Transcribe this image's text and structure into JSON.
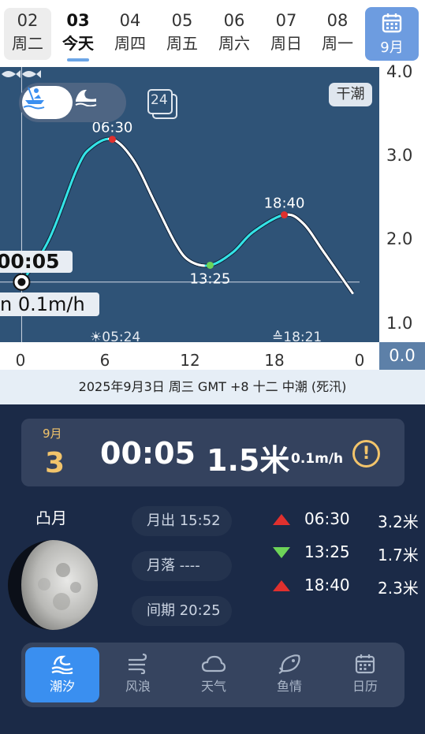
{
  "date_strip": {
    "days": [
      {
        "num": "02",
        "weekday": "周二"
      },
      {
        "num": "03",
        "weekday": "今天"
      },
      {
        "num": "04",
        "weekday": "周四"
      },
      {
        "num": "05",
        "weekday": "周五"
      },
      {
        "num": "06",
        "weekday": "周六"
      },
      {
        "num": "07",
        "weekday": "周日"
      },
      {
        "num": "08",
        "weekday": "周一"
      }
    ],
    "calendar_button": {
      "label": "9月",
      "icon": "calendar-icon"
    }
  },
  "chart": {
    "mode_options": [
      {
        "icon": "boat-fishing-icon",
        "active": true
      },
      {
        "icon": "wave-icon",
        "active": false
      }
    ],
    "range_icon_label": "24",
    "dry_tide_label": "干潮",
    "fish_icon": "fish-icon",
    "cursor": {
      "time": "00:05",
      "rate": "n  0.1m/h"
    },
    "sunrise": "05:24",
    "sunset": "18:21",
    "zero_value": "0.0",
    "colors": {
      "rising": "#34e3e6",
      "falling": "#ffffff",
      "background": "#2f5377",
      "high_marker": "#e0302e",
      "low_marker": "#6dd458"
    }
  },
  "chart_data": {
    "type": "line",
    "title": "",
    "xlabel": "",
    "ylabel": "",
    "xlim": [
      0,
      24
    ],
    "ylim": [
      0.75,
      4.0
    ],
    "x_ticks": [
      "0",
      "6",
      "12",
      "18",
      "0"
    ],
    "y_ticks": [
      "1.0",
      "2.0",
      "3.0",
      "4.0"
    ],
    "series": [
      {
        "x": [
          0.08,
          2,
          4,
          5,
          6.5,
          8,
          9.5,
          11,
          12,
          13.42,
          15,
          16.5,
          18.67,
          20,
          21.5,
          23.5
        ],
        "y": [
          1.5,
          2.0,
          2.85,
          3.1,
          3.2,
          2.95,
          2.45,
          1.95,
          1.75,
          1.7,
          1.85,
          2.1,
          2.3,
          2.2,
          1.85,
          1.37
        ]
      }
    ],
    "extremes": [
      {
        "time": "06:30",
        "x": 6.5,
        "y": 3.2,
        "kind": "high"
      },
      {
        "time": "13:25",
        "x": 13.42,
        "y": 1.7,
        "kind": "low"
      },
      {
        "time": "18:40",
        "x": 18.67,
        "y": 2.3,
        "kind": "high"
      }
    ],
    "cursor_x": 0.08,
    "cursor_y": 1.5,
    "grid": false
  },
  "info_line": "2025年9月3日  周三  GMT +8  十二  中潮 (死汛)",
  "now_card": {
    "month": "9月",
    "day": "3",
    "time": "00:05",
    "height": "1.5米",
    "rate": "0.1m/h",
    "warning": "!"
  },
  "moon": {
    "phase": "凸月",
    "icon": "moon-icon"
  },
  "moon_times": [
    {
      "label": "月出 15:52"
    },
    {
      "label": "月落 ----"
    },
    {
      "label": "间期 20:25"
    }
  ],
  "tide_table": [
    {
      "dir": "up",
      "time": "06:30",
      "height": "3.2米"
    },
    {
      "dir": "down",
      "time": "13:25",
      "height": "1.7米"
    },
    {
      "dir": "up",
      "time": "18:40",
      "height": "2.3米"
    }
  ],
  "tabs": [
    {
      "label": "潮汐",
      "icon": "tide-icon",
      "active": true
    },
    {
      "label": "风浪",
      "icon": "wind-icon",
      "active": false
    },
    {
      "label": "天气",
      "icon": "cloud-icon",
      "active": false
    },
    {
      "label": "鱼情",
      "icon": "fish-icon",
      "active": false
    },
    {
      "label": "日历",
      "icon": "calendar-icon",
      "active": false
    }
  ]
}
